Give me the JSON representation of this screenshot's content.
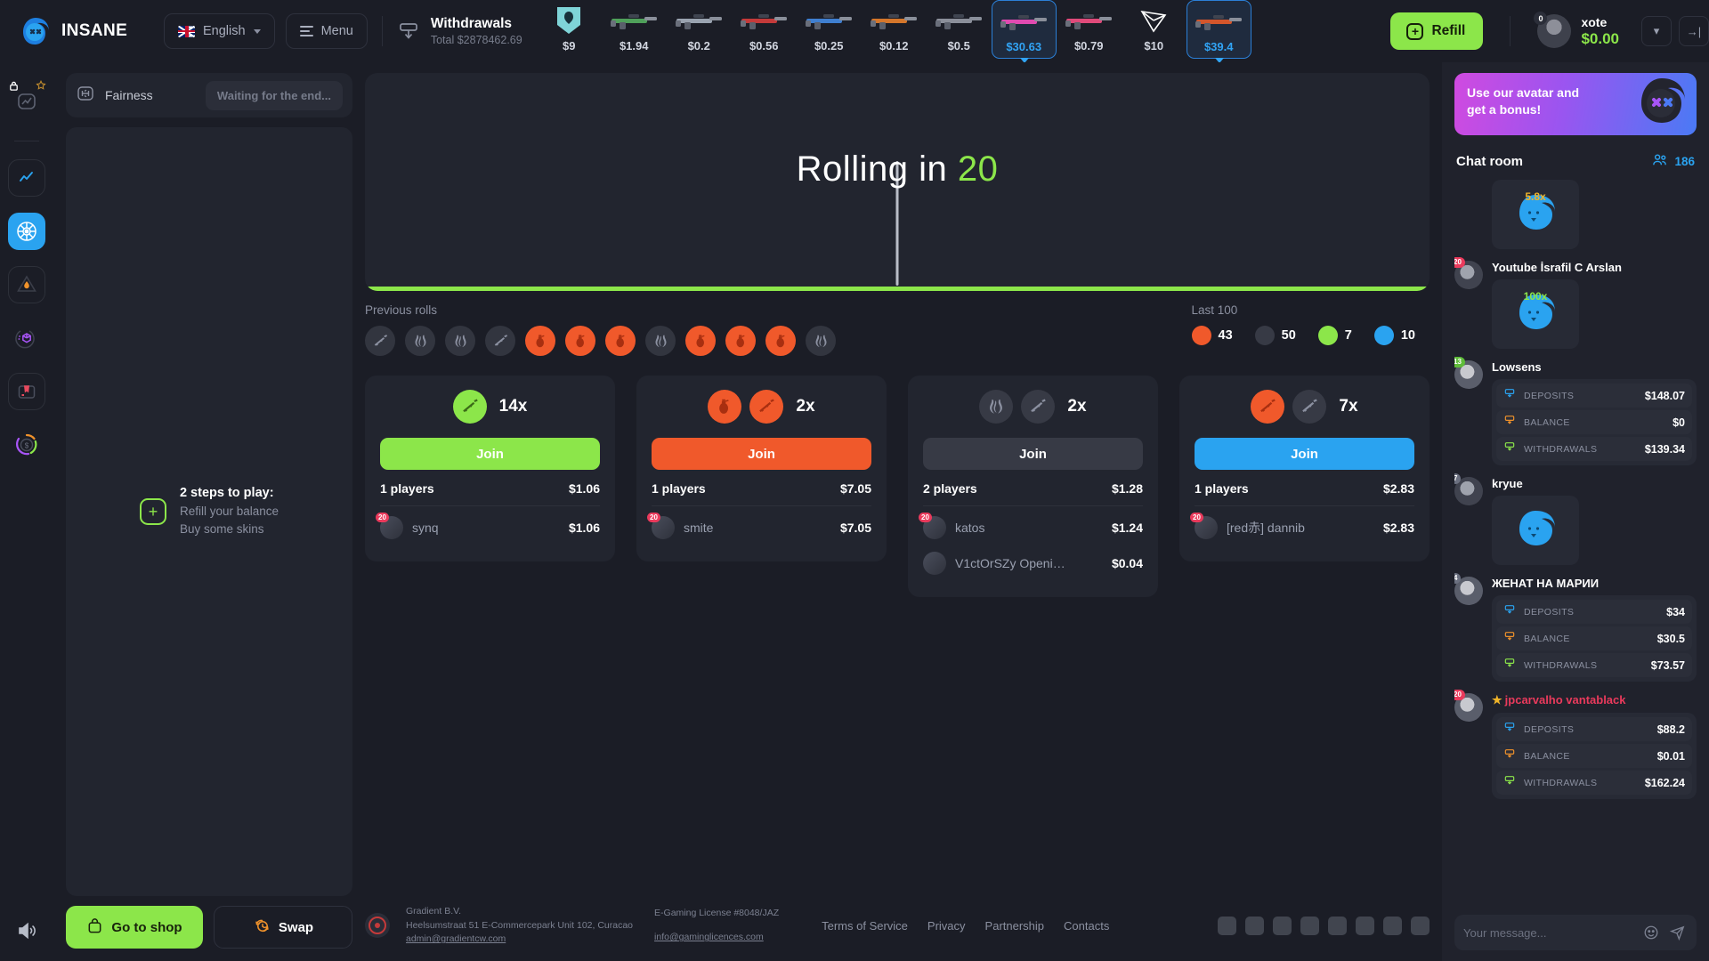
{
  "brand": {
    "name": "INSANE",
    "logo_icon": "insane-logo-icon"
  },
  "topbar": {
    "language": {
      "label": "English",
      "icon": "uk-flag-icon",
      "chevron": "chevron-down-icon"
    },
    "menu": {
      "label": "Menu",
      "icon": "hamburger-icon"
    },
    "withdrawals": {
      "title": "Withdrawals",
      "total": "Total $2878462.69",
      "icon": "withdraw-icon"
    },
    "items": [
      {
        "price": "$9",
        "icon": "sticker-icon",
        "active": false
      },
      {
        "price": "$1.94",
        "icon": "smg-icon",
        "active": false
      },
      {
        "price": "$0.2",
        "icon": "m4a4-icon",
        "active": false
      },
      {
        "price": "$0.56",
        "icon": "rifle-icon",
        "active": false
      },
      {
        "price": "$0.25",
        "icon": "pistol-icon",
        "active": false
      },
      {
        "price": "$0.12",
        "icon": "glock-icon",
        "active": false
      },
      {
        "price": "$0.5",
        "icon": "awp-icon",
        "active": false
      },
      {
        "price": "$30.63",
        "icon": "awp-pink-icon",
        "active": true
      },
      {
        "price": "$0.79",
        "icon": "mac10-icon",
        "active": false
      },
      {
        "price": "$10",
        "icon": "tron-icon",
        "active": false
      },
      {
        "price": "$39.4",
        "icon": "ak47-icon",
        "active": true
      }
    ],
    "refill": {
      "label": "Refill",
      "icon": "plus-icon",
      "color": "#8ce64a"
    },
    "user": {
      "name": "xote",
      "balance": "$0.00",
      "level": "0",
      "balance_color": "#8ce64a"
    },
    "collapse_icon": "chevron-down-icon",
    "logout_icon": "logout-icon"
  },
  "rail": {
    "items": [
      {
        "name": "locked-stats",
        "icon": "lock-star-chart-icon",
        "active": false,
        "locked": true
      },
      {
        "name": "stats",
        "icon": "chart-line-icon",
        "active": false
      },
      {
        "name": "roulette",
        "icon": "roulette-wheel-icon",
        "active": true
      },
      {
        "name": "crash",
        "icon": "flame-triangle-icon",
        "active": false
      },
      {
        "name": "cases",
        "icon": "cube-orbit-icon",
        "active": false
      },
      {
        "name": "case-battles",
        "icon": "case-box-icon",
        "active": false
      },
      {
        "name": "jackpot",
        "icon": "dollar-ring-icon",
        "active": false
      }
    ],
    "sound_icon": "sound-on-icon"
  },
  "left_panel": {
    "fairness": {
      "label": "Fairness",
      "icon": "fairness-icon"
    },
    "status": "Waiting for the end...",
    "steps": {
      "title": "2 steps to play:",
      "line1": "Refill your balance",
      "line2": "Buy some skins",
      "icon": "plus-icon"
    },
    "shop_button": {
      "label": "Go to shop",
      "icon": "shopping-bag-icon"
    },
    "swap_button": {
      "label": "Swap",
      "icon": "swap-icon"
    }
  },
  "game": {
    "roll_prefix": "Rolling in",
    "roll_seconds": "20",
    "previous_rolls_label": "Previous rolls",
    "previous_rolls": [
      {
        "type": "rifle",
        "color": "gray"
      },
      {
        "type": "bombs",
        "color": "gray"
      },
      {
        "type": "bombs",
        "color": "gray"
      },
      {
        "type": "rifle",
        "color": "gray"
      },
      {
        "type": "grenade",
        "color": "orange"
      },
      {
        "type": "grenade",
        "color": "orange"
      },
      {
        "type": "grenade",
        "color": "orange"
      },
      {
        "type": "bombs",
        "color": "gray"
      },
      {
        "type": "grenade",
        "color": "orange"
      },
      {
        "type": "grenade",
        "color": "orange"
      },
      {
        "type": "grenade",
        "color": "orange"
      },
      {
        "type": "bombs",
        "color": "gray"
      }
    ],
    "last100_label": "Last 100",
    "last100": [
      {
        "color": "#f0592b",
        "count": "43"
      },
      {
        "color": "#373a45",
        "count": "50"
      },
      {
        "color": "#8ce64a",
        "count": "7"
      },
      {
        "color": "#2aa3f0",
        "count": "10"
      }
    ],
    "wheel_sectors": [
      "#2a2d38",
      "#5a3630",
      "#22252f",
      "#4c6b33",
      "#22252f",
      "#5a3630",
      "#2a2d38"
    ]
  },
  "bets": [
    {
      "multiplier": "14x",
      "icons": [
        {
          "glyph": "rifle",
          "color": "green"
        }
      ],
      "join_label": "Join",
      "join_color": "green",
      "players_label": "1 players",
      "total": "$1.06",
      "players": [
        {
          "name": "synq",
          "amount": "$1.06",
          "level": "20"
        }
      ]
    },
    {
      "multiplier": "2x",
      "icons": [
        {
          "glyph": "grenade",
          "color": "orange"
        },
        {
          "glyph": "rifle",
          "color": "orange"
        }
      ],
      "join_label": "Join",
      "join_color": "orange",
      "players_label": "1 players",
      "total": "$7.05",
      "players": [
        {
          "name": "smite",
          "amount": "$7.05",
          "level": "20"
        }
      ]
    },
    {
      "multiplier": "2x",
      "icons": [
        {
          "glyph": "bombs",
          "color": "gray"
        },
        {
          "glyph": "rifle",
          "color": "gray"
        }
      ],
      "join_label": "Join",
      "join_color": "gray",
      "players_label": "2 players",
      "total": "$1.28",
      "players": [
        {
          "name": "katos",
          "amount": "$1.24",
          "level": "20"
        },
        {
          "name": "V1ctOrSZy Openi…",
          "amount": "$0.04",
          "level": ""
        }
      ]
    },
    {
      "multiplier": "7x",
      "icons": [
        {
          "glyph": "rifle",
          "color": "orange"
        },
        {
          "glyph": "rifle",
          "color": "gray"
        }
      ],
      "join_label": "Join",
      "join_color": "blue",
      "players_label": "1 players",
      "total": "$2.83",
      "players": [
        {
          "name": "[red赤] dannib",
          "amount": "$2.83",
          "level": "20"
        }
      ]
    }
  ],
  "footer": {
    "company": "Gradient B.V.",
    "address": "Heelsumstraat 51 E-Commercepark Unit 102, Curacao",
    "email": "admin@gradientcw.com",
    "license": "E-Gaming License #8048/JAZ",
    "license_email": "info@gaminglicences.com",
    "links": [
      "Terms of Service",
      "Privacy",
      "Partnership",
      "Contacts"
    ],
    "socials": [
      "instagram-icon",
      "tiktok-icon",
      "vk-icon",
      "facebook-icon",
      "telegram-icon",
      "twitter-icon",
      "discord-icon",
      "reddit-icon"
    ]
  },
  "chat": {
    "promo": {
      "line1_bold": "Use our avatar",
      "line1_rest": " and",
      "line2": "get a bonus!",
      "icon": "insane-mascot-icon"
    },
    "title": "Chat room",
    "online_count": "186",
    "online_icon": "people-icon",
    "messages": [
      {
        "name": "",
        "sticker": "5.8x",
        "sticker_color": "#2aa3f0",
        "level": "",
        "level_color": "",
        "type": "sticker",
        "partial": true
      },
      {
        "name": "Youtube İsrafil C Arslan",
        "sticker": "100x",
        "sticker_color": "#2aa3f0",
        "level": "20",
        "level_color": "#ea3a5c",
        "type": "sticker"
      },
      {
        "name": "Lowsens",
        "level": "13",
        "level_color": "#5fbd3a",
        "type": "stats",
        "stats": [
          {
            "label": "DEPOSITS",
            "value": "$148.07",
            "icon": "deposit-icon",
            "color": "#2aa3f0"
          },
          {
            "label": "BALANCE",
            "value": "$0",
            "icon": "coins-icon",
            "color": "#f0922b"
          },
          {
            "label": "WITHDRAWALS",
            "value": "$139.34",
            "icon": "withdraw-icon",
            "color": "#8ce64a"
          }
        ]
      },
      {
        "name": "kryue",
        "sticker": "",
        "sticker_color": "#2aa3f0",
        "level": "7",
        "level_color": "#6b7080",
        "type": "sticker"
      },
      {
        "name": "ЖЕНАТ НА МАРИИ",
        "level": "4",
        "level_color": "#6b7080",
        "type": "stats",
        "stats": [
          {
            "label": "DEPOSITS",
            "value": "$34",
            "icon": "deposit-icon",
            "color": "#2aa3f0"
          },
          {
            "label": "BALANCE",
            "value": "$30.5",
            "icon": "coins-icon",
            "color": "#f0922b"
          },
          {
            "label": "WITHDRAWALS",
            "value": "$73.57",
            "icon": "withdraw-icon",
            "color": "#8ce64a"
          }
        ]
      },
      {
        "name": "jpcarvalho vantablack",
        "level": "20",
        "level_color": "#ea3a5c",
        "type": "stats",
        "starred": true,
        "name_red": true,
        "stats": [
          {
            "label": "DEPOSITS",
            "value": "$88.2",
            "icon": "deposit-icon",
            "color": "#2aa3f0"
          },
          {
            "label": "BALANCE",
            "value": "$0.01",
            "icon": "coins-icon",
            "color": "#f0922b"
          },
          {
            "label": "WITHDRAWALS",
            "value": "$162.24",
            "icon": "withdraw-icon",
            "color": "#8ce64a"
          }
        ]
      }
    ],
    "input_placeholder": "Your message...",
    "emoji_icon": "emoji-icon",
    "send_icon": "send-icon"
  }
}
